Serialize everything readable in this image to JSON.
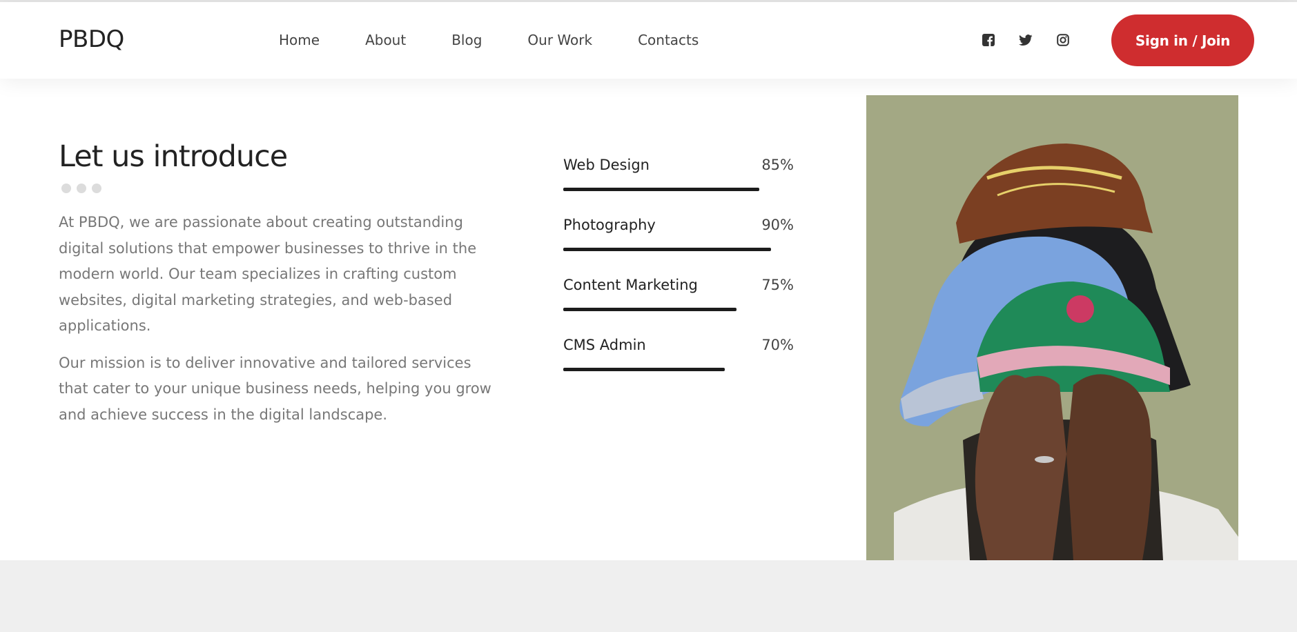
{
  "header": {
    "logo": "PBDQ",
    "nav": [
      "Home",
      "About",
      "Blog",
      "Our Work",
      "Contacts"
    ],
    "social_icons": [
      "facebook-icon",
      "twitter-icon",
      "instagram-icon"
    ],
    "signin_label": "Sign in / Join"
  },
  "intro": {
    "title": "Let us introduce",
    "paragraphs": [
      "At PBDQ, we are passionate about creating outstanding digital solutions that empower businesses to thrive in the modern world. Our team specializes in crafting custom websites, digital marketing strategies, and web-based applications.",
      "Our mission is to deliver innovative and tailored services that cater to your unique business needs, helping you grow and achieve success in the digital landscape."
    ]
  },
  "skills": [
    {
      "name": "Web Design",
      "percent_label": "85%",
      "value": 85
    },
    {
      "name": "Photography",
      "percent_label": "90%",
      "value": 90
    },
    {
      "name": "Content Marketing",
      "percent_label": "75%",
      "value": 75
    },
    {
      "name": "CMS Admin",
      "percent_label": "70%",
      "value": 70
    }
  ],
  "colors": {
    "accent": "#cf2d2f",
    "bar": "#1c1c1c",
    "photo_background": "#a3a884"
  }
}
